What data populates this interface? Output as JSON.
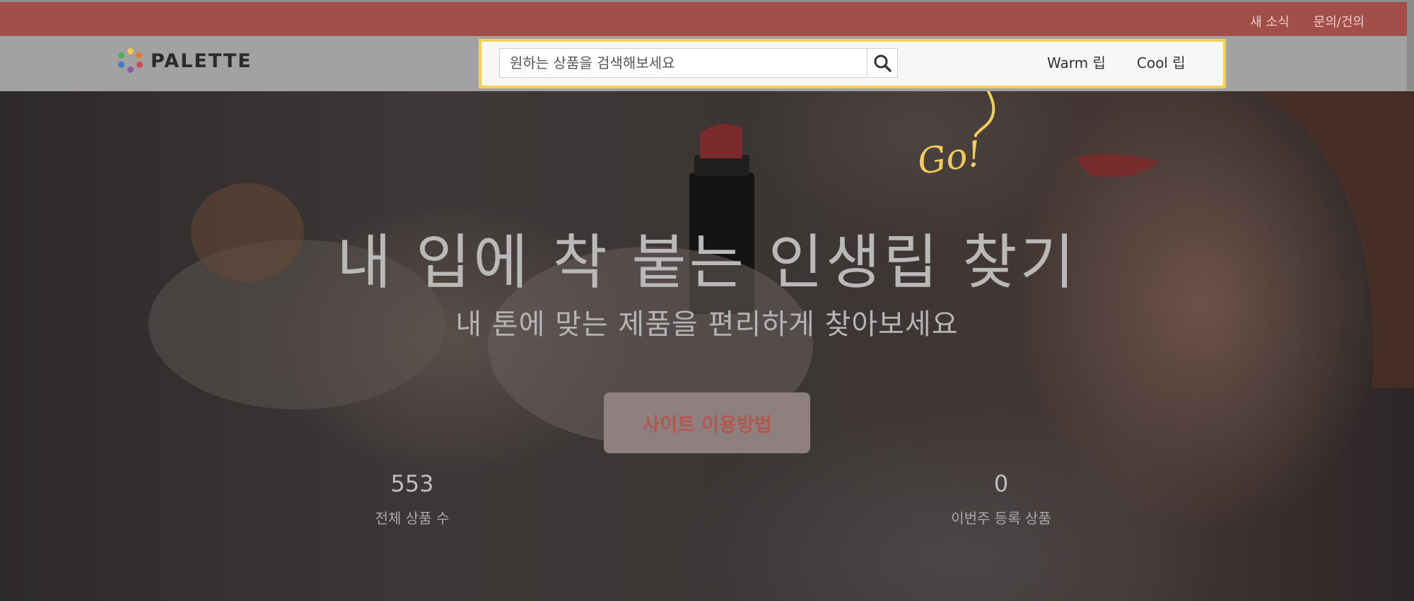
{
  "topbar": {
    "links": [
      "새 소식",
      "문의/건의"
    ]
  },
  "header": {
    "logo_text": "PALETTE",
    "search": {
      "placeholder": "원하는 상품을 검색해보세요",
      "value": ""
    },
    "tabs": [
      "Warm 립",
      "Cool 립"
    ]
  },
  "hero": {
    "annotation": "Go!",
    "headline": "내 입에 착 붙는 인생립 찾기",
    "subheadline": "내 톤에 맞는 제품을 편리하게 찾아보세요",
    "cta_label": "사이트 이용방법",
    "stats": [
      {
        "value": "553",
        "label": "전체 상품 수"
      },
      {
        "value": "0",
        "label": "이번주 등록 상품"
      }
    ]
  },
  "colors": {
    "topbar": "#a34e48",
    "highlight": "#f7cf58",
    "cta_text": "#b25750"
  },
  "icons": {
    "search_button": "search-icon",
    "logo": "palette-dots-icon"
  }
}
